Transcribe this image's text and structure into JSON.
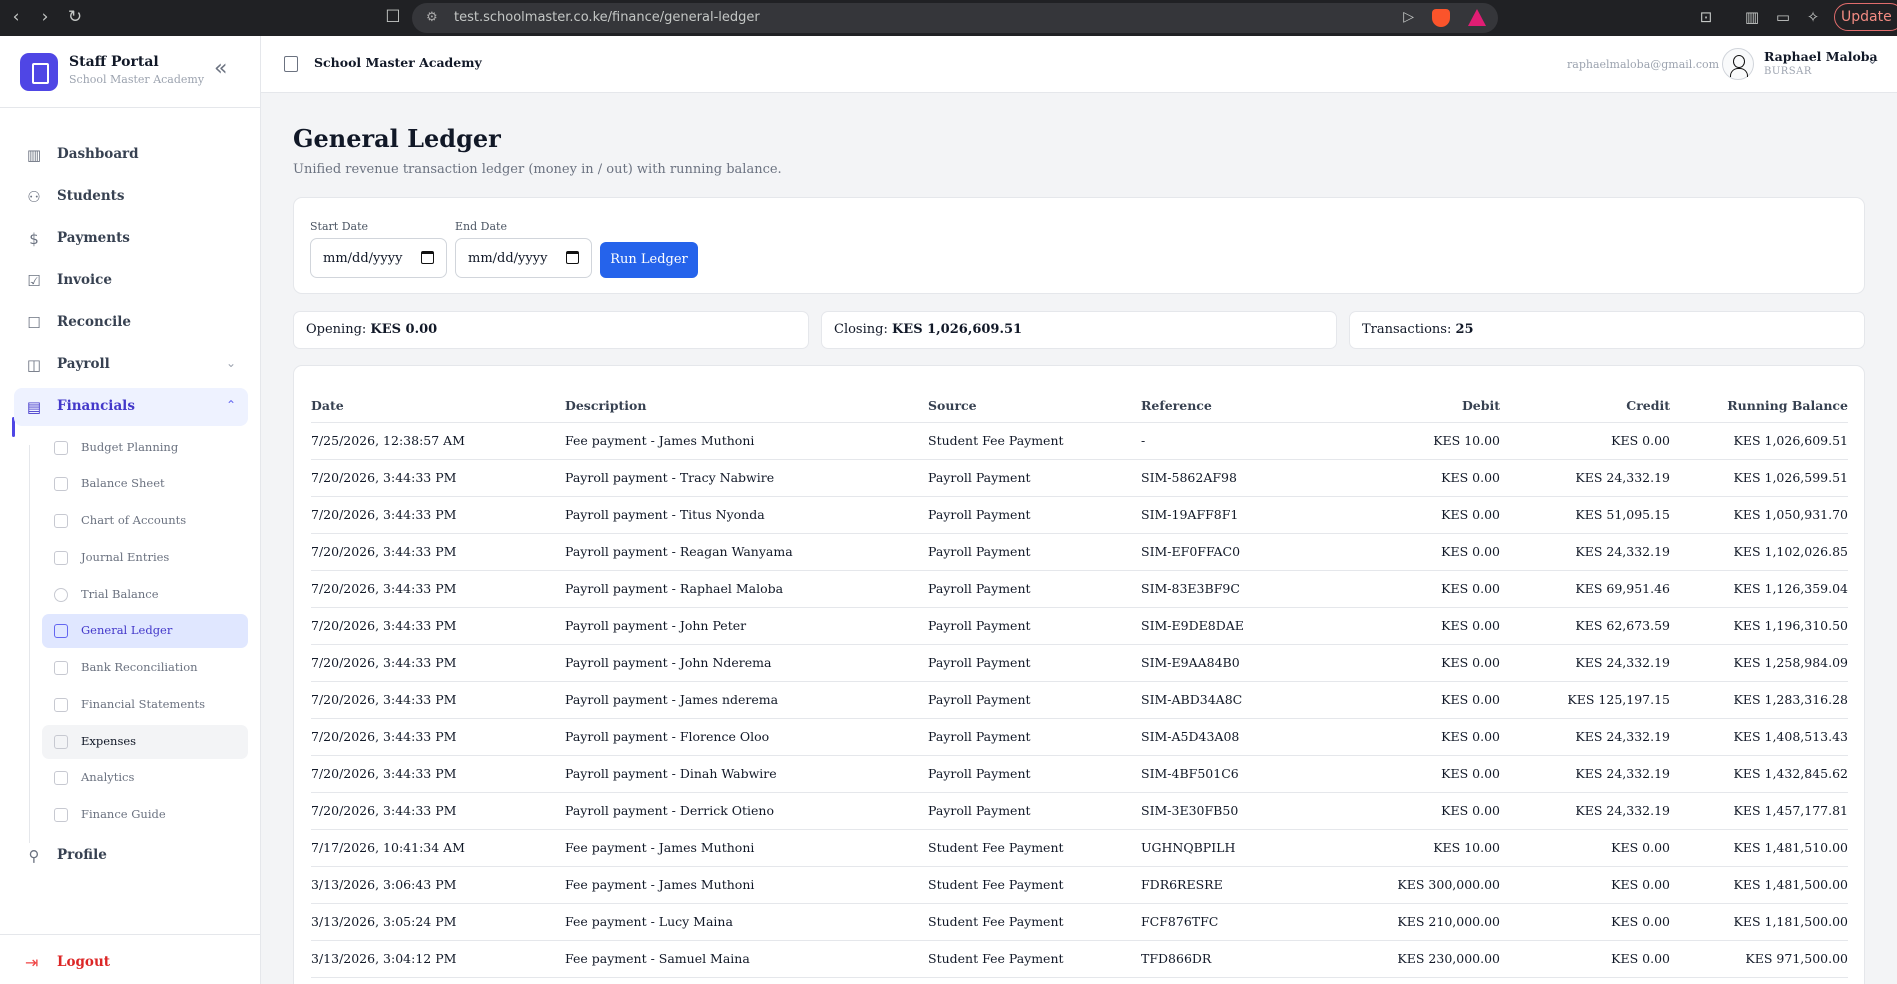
{
  "browser": {
    "url": "test.schoolmaster.co.ke/finance/general-ledger",
    "update_label": "Update"
  },
  "sidebar": {
    "brand_title": "Staff Portal",
    "brand_subtitle": "School Master Academy",
    "items": [
      {
        "label": "Dashboard",
        "icon": "chart-bar-icon"
      },
      {
        "label": "Students",
        "icon": "users-icon"
      },
      {
        "label": "Payments",
        "icon": "dollar-icon"
      },
      {
        "label": "Invoice",
        "icon": "document-icon"
      },
      {
        "label": "Reconcile",
        "icon": "clipboard-icon"
      },
      {
        "label": "Payroll",
        "icon": "camera-icon"
      },
      {
        "label": "Financials",
        "icon": "ledger-icon"
      }
    ],
    "financial_subitems": [
      {
        "label": "Budget Planning"
      },
      {
        "label": "Balance Sheet"
      },
      {
        "label": "Chart of Accounts"
      },
      {
        "label": "Journal Entries"
      },
      {
        "label": "Trial Balance"
      },
      {
        "label": "General Ledger"
      },
      {
        "label": "Bank Reconciliation"
      },
      {
        "label": "Financial Statements"
      },
      {
        "label": "Expenses"
      },
      {
        "label": "Analytics"
      },
      {
        "label": "Finance Guide"
      }
    ],
    "profile_label": "Profile",
    "logout_label": "Logout",
    "accent_color": "#4f46e5"
  },
  "header": {
    "school_name": "School Master Academy",
    "user_email": "raphaelmaloba@gmail.com",
    "user_name": "Raphael Maloba",
    "user_role": "BURSAR"
  },
  "main": {
    "title": "General Ledger",
    "subtitle": "Unified revenue transaction ledger (money in / out) with running balance.",
    "filters": {
      "start_label": "Start Date",
      "start_value": "mm/dd/yyyy",
      "end_label": "End Date",
      "end_value": "mm/dd/yyyy",
      "run_label": "Run Ledger"
    },
    "stats": {
      "opening_label": "Opening:",
      "opening_value": "KES 0.00",
      "closing_label": "Closing:",
      "closing_value": "KES 1,026,609.51",
      "transactions_label": "Transactions:",
      "transactions_value": "25"
    },
    "table": {
      "columns": [
        "Date",
        "Description",
        "Source",
        "Reference",
        "Debit",
        "Credit",
        "Running Balance"
      ],
      "rows": [
        [
          "7/25/2026, 12:38:57 AM",
          "Fee payment - James Muthoni",
          "Student Fee Payment",
          "-",
          "KES 10.00",
          "KES 0.00",
          "KES 1,026,609.51"
        ],
        [
          "7/20/2026, 3:44:33 PM",
          "Payroll payment - Tracy Nabwire",
          "Payroll Payment",
          "SIM-5862AF98",
          "KES 0.00",
          "KES 24,332.19",
          "KES 1,026,599.51"
        ],
        [
          "7/20/2026, 3:44:33 PM",
          "Payroll payment - Titus Nyonda",
          "Payroll Payment",
          "SIM-19AFF8F1",
          "KES 0.00",
          "KES 51,095.15",
          "KES 1,050,931.70"
        ],
        [
          "7/20/2026, 3:44:33 PM",
          "Payroll payment - Reagan Wanyama",
          "Payroll Payment",
          "SIM-EF0FFAC0",
          "KES 0.00",
          "KES 24,332.19",
          "KES 1,102,026.85"
        ],
        [
          "7/20/2026, 3:44:33 PM",
          "Payroll payment - Raphael Maloba",
          "Payroll Payment",
          "SIM-83E3BF9C",
          "KES 0.00",
          "KES 69,951.46",
          "KES 1,126,359.04"
        ],
        [
          "7/20/2026, 3:44:33 PM",
          "Payroll payment - John Peter",
          "Payroll Payment",
          "SIM-E9DE8DAE",
          "KES 0.00",
          "KES 62,673.59",
          "KES 1,196,310.50"
        ],
        [
          "7/20/2026, 3:44:33 PM",
          "Payroll payment - John Nderema",
          "Payroll Payment",
          "SIM-E9AA84B0",
          "KES 0.00",
          "KES 24,332.19",
          "KES 1,258,984.09"
        ],
        [
          "7/20/2026, 3:44:33 PM",
          "Payroll payment - James nderema",
          "Payroll Payment",
          "SIM-ABD34A8C",
          "KES 0.00",
          "KES 125,197.15",
          "KES 1,283,316.28"
        ],
        [
          "7/20/2026, 3:44:33 PM",
          "Payroll payment - Florence Oloo",
          "Payroll Payment",
          "SIM-A5D43A08",
          "KES 0.00",
          "KES 24,332.19",
          "KES 1,408,513.43"
        ],
        [
          "7/20/2026, 3:44:33 PM",
          "Payroll payment - Dinah Wabwire",
          "Payroll Payment",
          "SIM-4BF501C6",
          "KES 0.00",
          "KES 24,332.19",
          "KES 1,432,845.62"
        ],
        [
          "7/20/2026, 3:44:33 PM",
          "Payroll payment - Derrick Otieno",
          "Payroll Payment",
          "SIM-3E30FB50",
          "KES 0.00",
          "KES 24,332.19",
          "KES 1,457,177.81"
        ],
        [
          "7/17/2026, 10:41:34 AM",
          "Fee payment - James Muthoni",
          "Student Fee Payment",
          "UGHNQBPILH",
          "KES 10.00",
          "KES 0.00",
          "KES 1,481,510.00"
        ],
        [
          "3/13/2026, 3:06:43 PM",
          "Fee payment - James Muthoni",
          "Student Fee Payment",
          "FDR6RESRE",
          "KES 300,000.00",
          "KES 0.00",
          "KES 1,481,500.00"
        ],
        [
          "3/13/2026, 3:05:24 PM",
          "Fee payment - Lucy Maina",
          "Student Fee Payment",
          "FCF876TFC",
          "KES 210,000.00",
          "KES 0.00",
          "KES 1,181,500.00"
        ],
        [
          "3/13/2026, 3:04:12 PM",
          "Fee payment - Samuel Maina",
          "Student Fee Payment",
          "TFD866DR",
          "KES 230,000.00",
          "KES 0.00",
          "KES 971,500.00"
        ]
      ]
    }
  }
}
